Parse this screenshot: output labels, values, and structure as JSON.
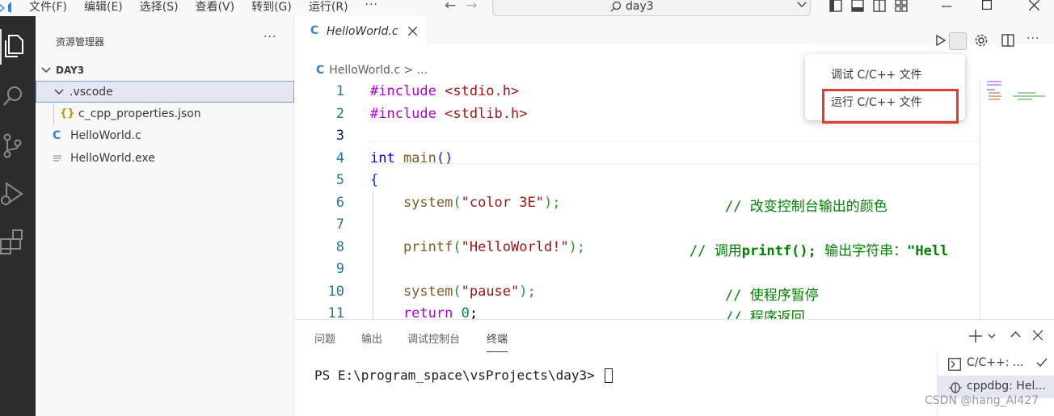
{
  "titlebar": {
    "menu": [
      "文件(F)",
      "编辑(E)",
      "选择(S)",
      "查看(V)",
      "转到(G)",
      "运行(R)",
      "···"
    ],
    "search_label": "day3"
  },
  "explorer": {
    "title": "资源管理器",
    "more": "···",
    "root": "DAY3",
    "items": [
      {
        "label": ".vscode"
      },
      {
        "label": "c_cpp_properties.json",
        "icon": "{}"
      },
      {
        "label": "HelloWorld.c",
        "icon": "C"
      },
      {
        "label": "HelloWorld.exe"
      }
    ]
  },
  "editor": {
    "tab_icon": "C",
    "tab_label": "HelloWorld.c",
    "breadcrumb_icon": "C",
    "breadcrumb": "HelloWorld.c > ...",
    "line_numbers": [
      "1",
      "2",
      "3",
      "4",
      "5",
      "6",
      "7",
      "8",
      "9",
      "10",
      "11"
    ],
    "code": {
      "l1_kw": "#include",
      "l1_rest": " <stdio.h>",
      "l2_kw": "#include",
      "l2_rest": " <stdlib.h>",
      "l4_type": "int",
      "l4_fn": " main",
      "l4_paren": "()",
      "l5": "{",
      "l6_fn": "    system",
      "l6_p1": "(",
      "l6_str": "\"color 3E\"",
      "l6_p2": ");",
      "l6_cm": "// 改变控制台输出的颜色",
      "l8_fn": "    printf",
      "l8_p1": "(",
      "l8_str": "\"HelloWorld!\"",
      "l8_p2": ");",
      "l8_cm_a": "// 调用",
      "l8_cm_b": "printf();",
      "l8_cm_c": " 输出字符串：",
      "l8_cm_d": "\"Hell",
      "l10_fn": "    system",
      "l10_p1": "(",
      "l10_str": "\"pause\"",
      "l10_p2": ");",
      "l10_cm": "// 使程序暂停",
      "l11_kw": "    return",
      "l11_num": " 0",
      "l11_rest": ";",
      "l11_cm": "// 程序返回"
    }
  },
  "run_menu": {
    "items": [
      "调试 C/C++ 文件",
      "运行 C/C++ 文件"
    ]
  },
  "panel": {
    "tabs": [
      "问题",
      "输出",
      "调试控制台",
      "终端"
    ],
    "active_tab": "终端",
    "prompt": "PS E:\\program_space\\vsProjects\\day3> ",
    "terminals": [
      "C/C++: ...",
      "cppdbg: Hel..."
    ]
  },
  "watermark": "CSDN @hang_AI427",
  "colors": {
    "activity_bar": "#2c2c2c",
    "accent": "#3a80c2",
    "highlight_box": "#e53935"
  }
}
